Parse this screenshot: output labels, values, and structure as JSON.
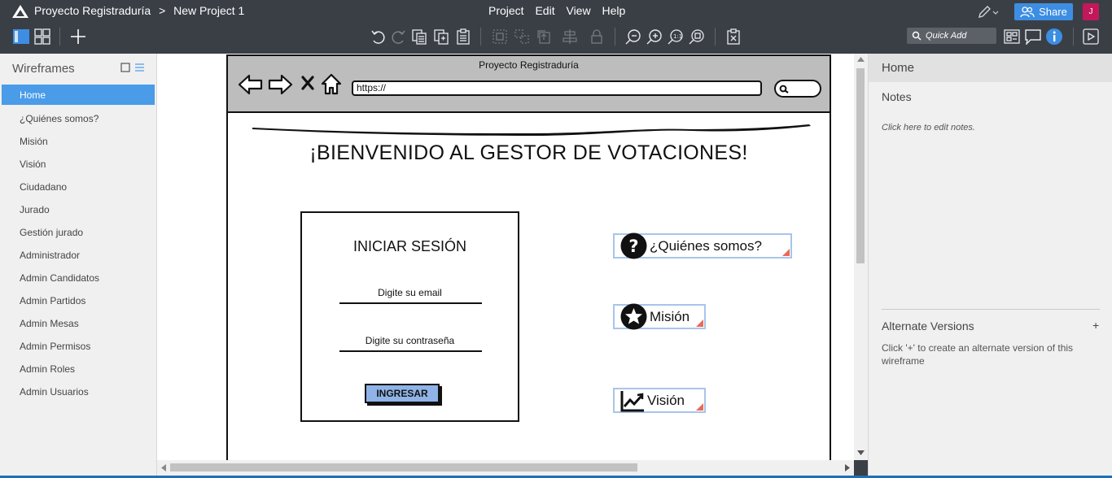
{
  "app": {
    "breadcrumb_project": "Proyecto Registraduría",
    "breadcrumb_sep": ">",
    "breadcrumb_page": "New Project 1",
    "menu": [
      "Project",
      "Edit",
      "View",
      "Help"
    ],
    "share_label": "Share",
    "user_initial": "J",
    "quick_add_placeholder": "Quick Add"
  },
  "left_panel": {
    "title": "Wireframes",
    "items": [
      {
        "label": "Home",
        "active": true
      },
      {
        "label": "¿Quiénes somos?"
      },
      {
        "label": "Misión"
      },
      {
        "label": "Visión"
      },
      {
        "label": "Ciudadano"
      },
      {
        "label": "Jurado"
      },
      {
        "label": "Gestión jurado"
      },
      {
        "label": "Administrador"
      },
      {
        "label": "Admin Candidatos"
      },
      {
        "label": "Admin Partidos"
      },
      {
        "label": "Admin Mesas"
      },
      {
        "label": "Admin Permisos"
      },
      {
        "label": "Admin Roles"
      },
      {
        "label": "Admin Usuarios"
      }
    ]
  },
  "mockup": {
    "window_title": "Proyecto Registraduría",
    "url": "https://",
    "heading": "¡BIENVENIDO AL GESTOR DE VOTACIONES!",
    "login": {
      "title": "INICIAR SESIÓN",
      "email_label": "Digite su email",
      "password_label": "Digite su contraseña",
      "submit_label": "INGRESAR"
    },
    "links": {
      "quienes": "¿Quiénes somos?",
      "mision": "Misión",
      "vision": "Visión"
    }
  },
  "right_panel": {
    "page_name": "Home",
    "notes_title": "Notes",
    "notes_hint": "Click here to edit notes.",
    "alt_title": "Alternate Versions",
    "alt_plus": "+",
    "alt_hint": "Click '+' to create an alternate version of this wireframe"
  },
  "colors": {
    "chrome": "#3a3f46",
    "accent": "#4a9be8",
    "share": "#3d8ee3",
    "button_fill": "#8fb3e6",
    "link_border": "#a9c4ea",
    "user_badge": "#c2185b"
  }
}
